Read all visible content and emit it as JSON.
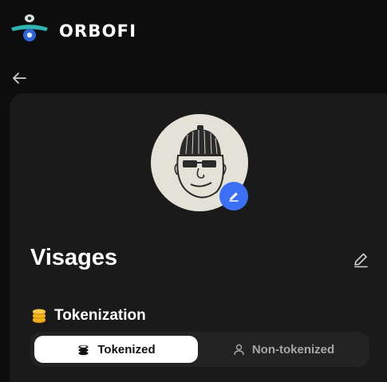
{
  "header": {
    "brand": "ORBOFI"
  },
  "profile": {
    "name": "Visages"
  },
  "tokenization": {
    "title": "Tokenization",
    "tabs": [
      {
        "label": "Tokenized",
        "icon": "coins-icon",
        "selected": true
      },
      {
        "label": "Non-tokenized",
        "icon": "user-icon",
        "selected": false
      }
    ]
  },
  "colors": {
    "accent": "#3b6ff5",
    "logo_teal": "#2fb4b1",
    "coin": "#f2b51c",
    "card": "#1a1a1b"
  }
}
